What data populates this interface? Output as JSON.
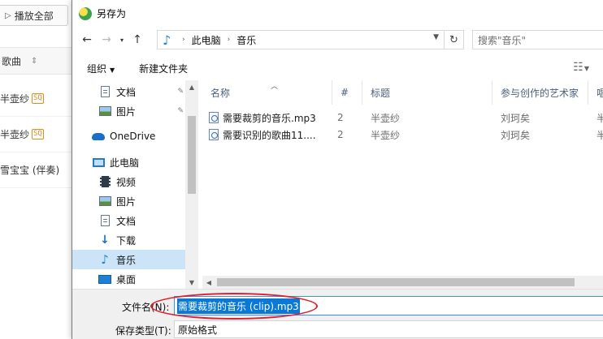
{
  "background_app": {
    "play_all_label": "播放全部",
    "song_header": "歌曲",
    "rows": [
      {
        "text": "半壶纱",
        "badge": "SQ"
      },
      {
        "text": "半壶纱",
        "badge": "SQ"
      },
      {
        "text": "雪宝宝 (伴奏)",
        "badge": ""
      }
    ]
  },
  "dialog": {
    "title": "另存为",
    "address": {
      "crumbs": [
        "此电脑",
        "音乐"
      ]
    },
    "search_placeholder": "搜索\"音乐\"",
    "toolbar": {
      "organize": "组织",
      "new_folder": "新建文件夹"
    },
    "nav_pane": {
      "items": [
        {
          "label": "文档",
          "icon": "document-icon",
          "pinned": true
        },
        {
          "label": "图片",
          "icon": "pictures-icon",
          "pinned": true
        },
        {
          "label": "OneDrive",
          "icon": "onedrive-icon",
          "pinned": false
        },
        {
          "label": "此电脑",
          "icon": "this-pc-icon",
          "pinned": false
        },
        {
          "label": "视频",
          "icon": "videos-icon",
          "pinned": false
        },
        {
          "label": "图片",
          "icon": "pictures-icon",
          "pinned": false
        },
        {
          "label": "文档",
          "icon": "document-icon",
          "pinned": false
        },
        {
          "label": "下载",
          "icon": "downloads-icon",
          "pinned": false
        },
        {
          "label": "音乐",
          "icon": "music-icon",
          "pinned": false,
          "selected": true
        },
        {
          "label": "桌面",
          "icon": "desktop-icon",
          "pinned": false
        }
      ]
    },
    "columns": [
      "名称",
      "#",
      "标题",
      "参与创作的艺术家",
      "唱"
    ],
    "files": [
      {
        "name": "需要裁剪的音乐.mp3",
        "num": "2",
        "title": "半壶纱",
        "artist": "刘珂矣",
        "extra": "半"
      },
      {
        "name": "需要识别的歌曲11....",
        "num": "2",
        "title": "半壶纱",
        "artist": "刘珂矣",
        "extra": "半"
      }
    ],
    "filename_label": "文件名(N):",
    "filename_value": "需要裁剪的音乐 (clip).mp3",
    "filetype_label": "保存类型(T):",
    "filetype_value": "原始格式"
  },
  "colors": {
    "accent": "#0a78d7",
    "selected_nav": "#cce4f7",
    "annotation_circle": "#e0202a"
  }
}
